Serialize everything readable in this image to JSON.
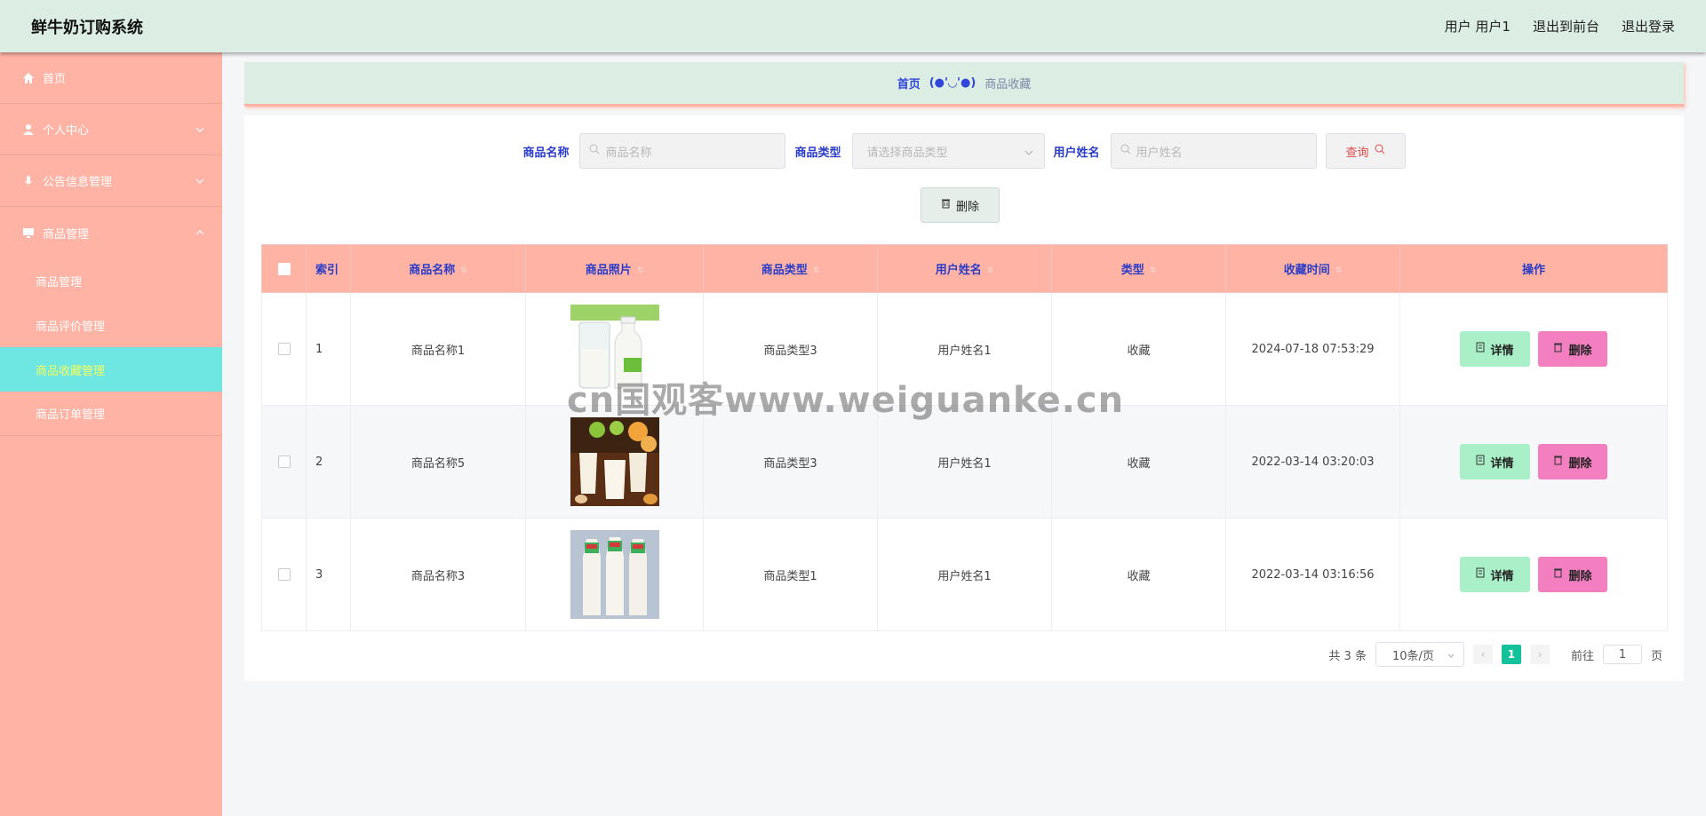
{
  "app": {
    "title": "鲜牛奶订购系统"
  },
  "header": {
    "user_label": "用户 用户1",
    "to_front": "退出到前台",
    "logout": "退出登录"
  },
  "sidebar": {
    "home": "首页",
    "personal": "个人中心",
    "notice": "公告信息管理",
    "goods": "商品管理",
    "sub": [
      "商品管理",
      "商品评价管理",
      "商品收藏管理",
      "商品订单管理"
    ]
  },
  "breadcrumb": {
    "home": "首页",
    "sep": "(●'◡'●)",
    "current": "商品收藏"
  },
  "search": {
    "name_label": "商品名称",
    "name_placeholder": "商品名称",
    "type_label": "商品类型",
    "type_placeholder": "请选择商品类型",
    "user_label": "用户姓名",
    "user_placeholder": "用户姓名",
    "query": "查询"
  },
  "actions": {
    "delete": "删除"
  },
  "table": {
    "headers": [
      "索引",
      "商品名称",
      "商品照片",
      "商品类型",
      "用户姓名",
      "类型",
      "收藏时间",
      "操作"
    ],
    "rows": [
      {
        "index": "1",
        "name": "商品名称1",
        "type": "商品类型3",
        "user": "用户姓名1",
        "kind": "收藏",
        "time": "2024-07-18 07:53:29"
      },
      {
        "index": "2",
        "name": "商品名称5",
        "type": "商品类型3",
        "user": "用户姓名1",
        "kind": "收藏",
        "time": "2022-03-14 03:20:03"
      },
      {
        "index": "3",
        "name": "商品名称3",
        "type": "商品类型1",
        "user": "用户姓名1",
        "kind": "收藏",
        "time": "2022-03-14 03:16:56"
      }
    ],
    "detail": "详情",
    "delete": "删除"
  },
  "pagination": {
    "total": "共 3 条",
    "size": "10条/页",
    "page": "1",
    "goto": "前往",
    "goto_value": "1",
    "page_unit": "页"
  },
  "watermark": "cn国观客www.weiguanke.cn",
  "colors": {
    "sidebar": "#ffb3a4",
    "header": "#dcede4",
    "active": "#6ee6e2",
    "detail": "#a9f0c8",
    "delete": "#f37fc0",
    "page": "#13c29a"
  }
}
